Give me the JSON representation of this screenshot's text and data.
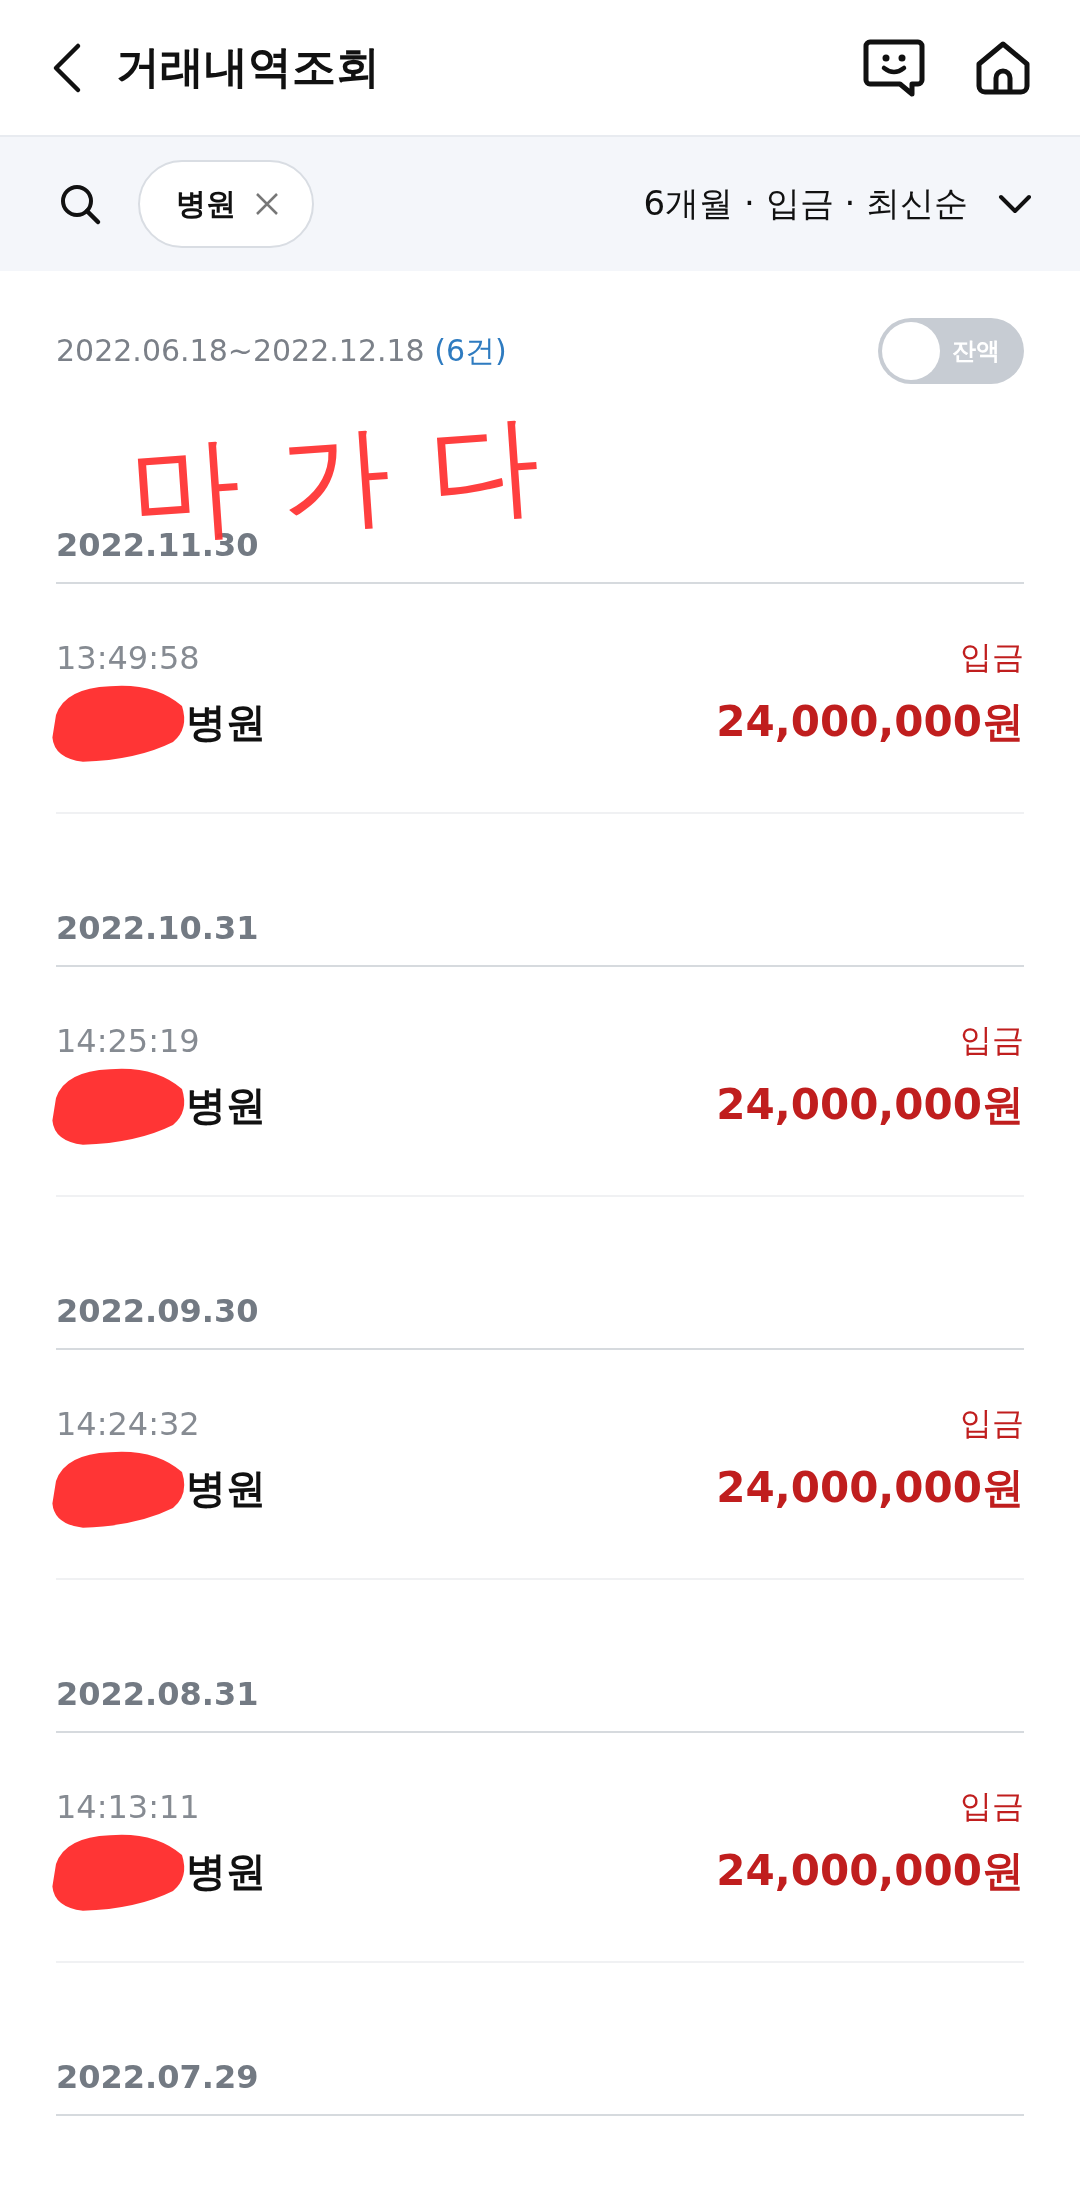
{
  "header": {
    "title": "거래내역조회"
  },
  "filter": {
    "chip": "병원",
    "summary": "6개월 · 입금 · 최신순"
  },
  "period": {
    "range": "2022.06.18~2022.12.18",
    "count": "(6건)"
  },
  "balance_toggle": {
    "label": "잔액",
    "on": false
  },
  "handwritten_overlay": "마가다",
  "groups": [
    {
      "date": "2022.11.30",
      "transactions": [
        {
          "time": "13:49:58",
          "type": "입금",
          "name": "병원",
          "amount": "24,000,000원",
          "redacted": true
        }
      ]
    },
    {
      "date": "2022.10.31",
      "transactions": [
        {
          "time": "14:25:19",
          "type": "입금",
          "name": "병원",
          "amount": "24,000,000원",
          "redacted": true
        }
      ]
    },
    {
      "date": "2022.09.30",
      "transactions": [
        {
          "time": "14:24:32",
          "type": "입금",
          "name": "병원",
          "amount": "24,000,000원",
          "redacted": true
        }
      ]
    },
    {
      "date": "2022.08.31",
      "transactions": [
        {
          "time": "14:13:11",
          "type": "입금",
          "name": "병원",
          "amount": "24,000,000원",
          "redacted": true
        }
      ]
    },
    {
      "date": "2022.07.29"
    }
  ]
}
